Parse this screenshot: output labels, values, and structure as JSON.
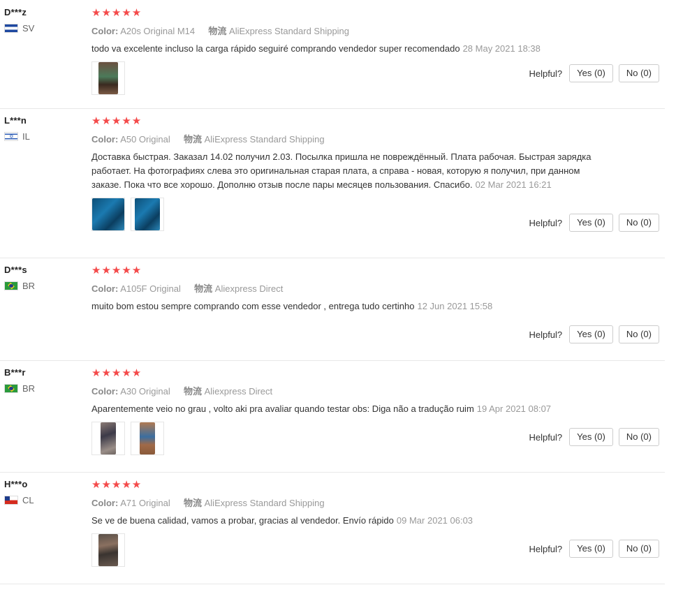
{
  "labels": {
    "color": "Color:",
    "logistics": "物流",
    "helpful": "Helpful?",
    "yes": "Yes (0)",
    "no": "No (0)"
  },
  "rating": "★★★★★",
  "reviews": [
    {
      "user": "D***z",
      "country": "SV",
      "color_value": "A20s Original M14",
      "shipping": "AliExpress Standard Shipping",
      "text": "todo va excelente incluso la carga rápido seguiré comprando vendedor super recomendado",
      "date": "28 May 2021 18:38"
    },
    {
      "user": "L***n",
      "country": "IL",
      "color_value": "A50 Original",
      "shipping": "AliExpress Standard Shipping",
      "text": "Доставка быстрая. Заказал 14.02 получил 2.03. Посылка пришла не повреждённый. Плата рабочая. Быстрая зарядка работает. На фотографиях слева это оригинальная старая плата, а справа - новая, которую я получил, при данном заказе. Пока что все хорошо. Дополню отзыв после пары месяцев пользования. Спасибо.",
      "date": "02 Mar 2021 16:21"
    },
    {
      "user": "D***s",
      "country": "BR",
      "color_value": "A105F Original",
      "shipping": "Aliexpress Direct",
      "text": "muito bom estou sempre comprando com esse vendedor , entrega tudo certinho",
      "date": "12 Jun 2021 15:58"
    },
    {
      "user": "B***r",
      "country": "BR",
      "color_value": "A30 Original",
      "shipping": "Aliexpress Direct",
      "text": "Aparentemente veio no grau , volto aki pra avaliar quando testar obs: Diga não a tradução ruim",
      "date": "19 Apr 2021 08:07"
    },
    {
      "user": "H***o",
      "country": "CL",
      "color_value": "A71 Original",
      "shipping": "AliExpress Standard Shipping",
      "text": "Se ve de buena calidad, vamos a probar, gracias al vendedor. Envío rápido",
      "date": "09 Mar 2021 06:03"
    }
  ]
}
